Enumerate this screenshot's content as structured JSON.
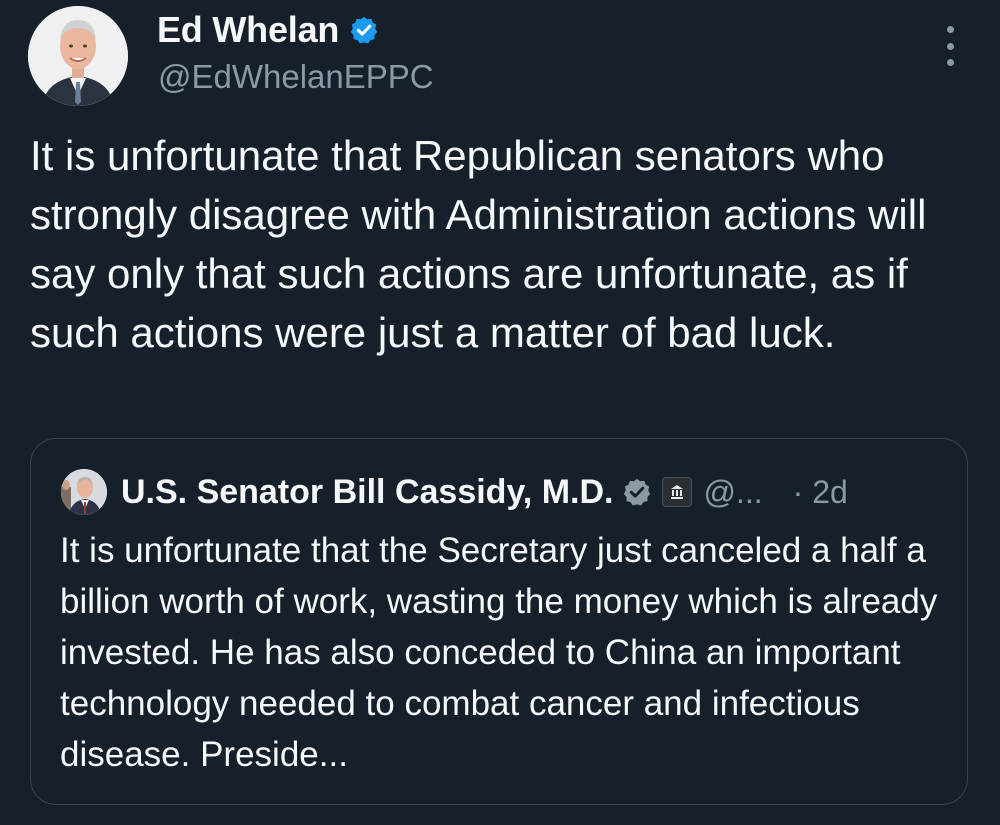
{
  "author": {
    "display_name": "Ed Whelan",
    "handle": "@EdWhelanEPPC",
    "verified": true
  },
  "tweet": {
    "text": "It is unfortunate that Republican senators who strongly disagree with Administration actions will say only that such actions are unfortunate, as if such actions were just a matter of bad luck."
  },
  "quoted_tweet": {
    "display_name": "U.S. Senator Bill Cassidy, M.D.",
    "handle": "@...",
    "time": "· 2d",
    "verified": true,
    "badge_icon": "government-building-icon",
    "text": "It is unfortunate that the Secretary just canceled a half a billion worth of work, wasting the money which is already invested. He has also conceded to China an important technology needed to combat cancer and infectious disease. Preside..."
  },
  "colors": {
    "background": "#16202a",
    "text": "#f5f7f9",
    "secondary_text": "#8b98a5",
    "verified_badge": "#1d9bf0",
    "border": "#38444d"
  }
}
